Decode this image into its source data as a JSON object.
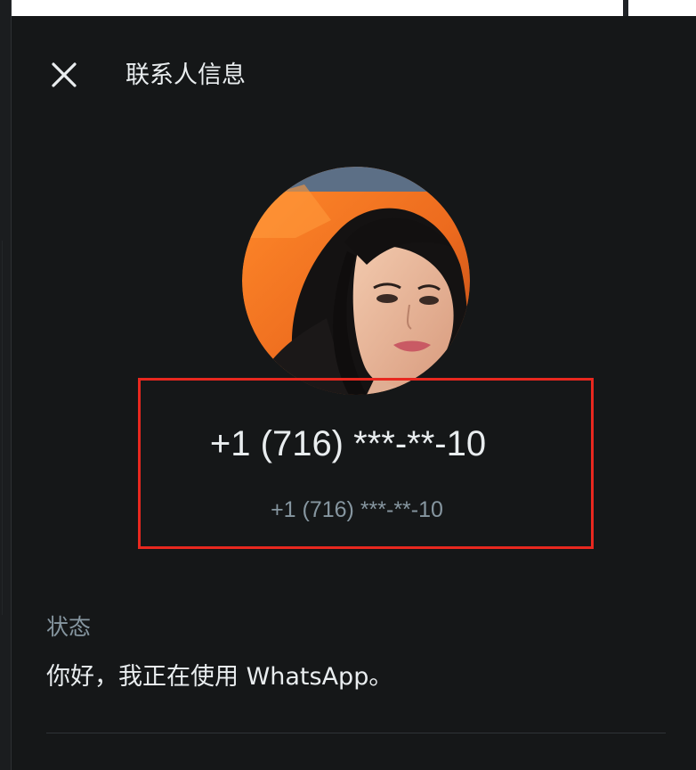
{
  "header": {
    "title": "联系人信息",
    "close_icon": "close-icon"
  },
  "contact": {
    "phone": "+1 (716) ***-**-10",
    "phone_secondary": "+1 (716) ***-**-10",
    "avatar_icon": "profile-photo"
  },
  "about": {
    "label": "状态",
    "text": "你好，我正在使用 WhatsApp。"
  },
  "colors": {
    "background": "#151718",
    "primary_text": "#e9edef",
    "secondary_text": "#8696a0",
    "highlight": "#e8281f"
  }
}
